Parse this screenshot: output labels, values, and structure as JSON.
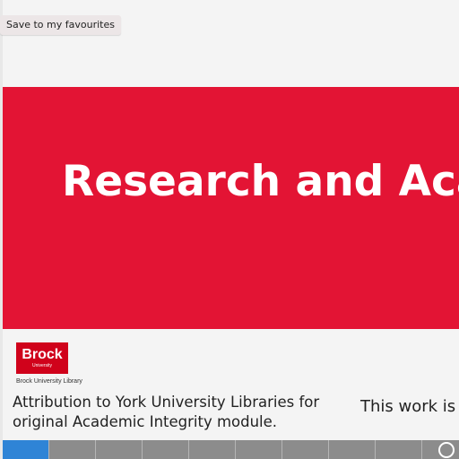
{
  "favourite_button": {
    "label": "Save to my favourites"
  },
  "slide": {
    "title": "Research and Aca",
    "title_color": "#ffffff",
    "banner_color": "#e31434"
  },
  "logo": {
    "word": "Brock",
    "sub": "University",
    "caption": "Brock University Library",
    "color": "#d0021b"
  },
  "footer": {
    "attribution": "Attribution to York University Libraries for original Academic Integrity module.",
    "license_text": "This work is"
  },
  "progress": {
    "segments_total": 10,
    "segments_done": 1,
    "accent": "#2f84d6",
    "control_icon": "circle-icon"
  }
}
